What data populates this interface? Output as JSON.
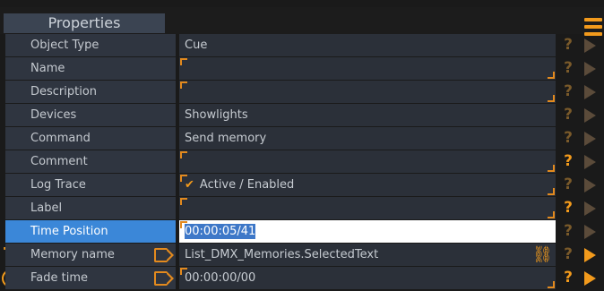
{
  "header": {
    "title": "Properties",
    "menu_icon": "hamburger-menu-icon"
  },
  "rows": [
    {
      "label": "Object Type",
      "value": "Cue"
    },
    {
      "label": "Name",
      "value": ""
    },
    {
      "label": "Description",
      "value": ""
    },
    {
      "label": "Devices",
      "value": "Showlights"
    },
    {
      "label": "Command",
      "value": "Send memory"
    },
    {
      "label": "Comment",
      "value": ""
    },
    {
      "label": "Log Trace",
      "value": "Active / Enabled",
      "check_icon": "checkmark-icon"
    },
    {
      "label": "Label",
      "value": ""
    },
    {
      "label": "Time Position",
      "value": "00:00:05/41"
    },
    {
      "label": "Memory name",
      "value": "List_DMX_Memories.SelectedText"
    },
    {
      "label": "Fade time",
      "value": "00:00:00/00"
    }
  ],
  "icons": {
    "help": "?",
    "play": "play-icon",
    "text": "T",
    "link": "chain-link-icon",
    "clock": "clock-icon"
  },
  "colors": {
    "accent": "#f29a1c",
    "active_label": "#3b87d8",
    "label_bg": "#2f3540",
    "value_bg": "#2b3039"
  }
}
